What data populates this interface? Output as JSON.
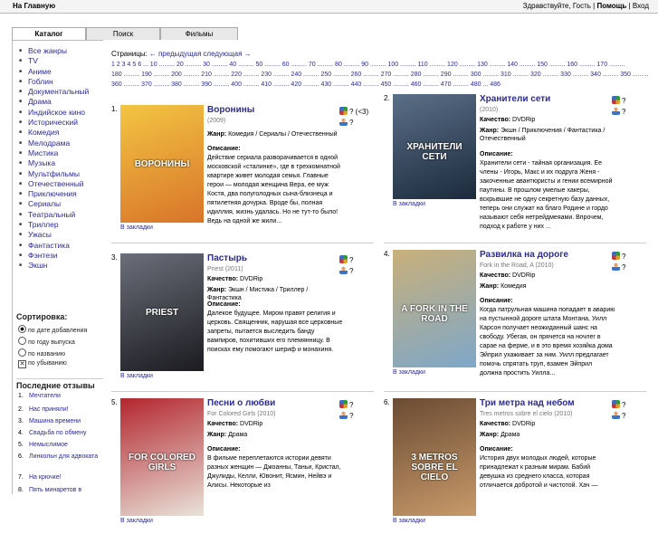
{
  "topbar": {
    "home": "На Главную",
    "greeting": "Здравствуйте, Гость",
    "sep1": " | ",
    "help": "Помощь",
    "sep2": " | ",
    "login": "Вход"
  },
  "tabs": [
    "Каталог",
    "Поиск",
    "Фильмы"
  ],
  "genres": [
    "Все жанры",
    "TV",
    "Аниме",
    "Гоблин",
    "Документальный",
    "Драма",
    "Индийское кино",
    "Исторический",
    "Комедия",
    "Мелодрама",
    "Мистика",
    "Музыка",
    "Мультфильмы",
    "Отечественный",
    "Приключения",
    "Сериалы",
    "Театральный",
    "Триллер",
    "Ужасы",
    "Фантастика",
    "Фэнтези",
    "Экшн"
  ],
  "sort": {
    "title": "Сортировка:",
    "options": [
      "по дате добавления",
      "по году выпуска",
      "по названию",
      "по убыванию"
    ]
  },
  "reviews": {
    "title": "Последние отзывы",
    "items": [
      {
        "n": "1.",
        "t": "Мечтатели"
      },
      {
        "n": "2.",
        "t": "Нас приняли!"
      },
      {
        "n": "3.",
        "t": "Машина времени"
      },
      {
        "n": "4.",
        "t": "Свадьба по обмену"
      },
      {
        "n": "5.",
        "t": "Немыслимое"
      },
      {
        "n": "6.",
        "t": "Линкольн для адвоката"
      },
      {
        "n": "7.",
        "t": "На крючке!"
      },
      {
        "n": "8.",
        "t": "Пять минаретов в"
      }
    ]
  },
  "pagination": {
    "label": "Страницы:",
    "prev": "← предыдущая",
    "next": "следующая →",
    "line2": "1 2 3 4 5 6 ... 10 ......... 20 ......... 30 ......... 40 ......... 50 ......... 60 ......... 70 ......... 80 ......... 90 ......... 100 ......... 110 ......... 120 ......... 130 ......... 140 ......... 150 ......... 160 ......... 170 .........",
    "line3": "180 ......... 190 ......... 200 ......... 210 ......... 220 ......... 230 ......... 240 ......... 250 ......... 260 ......... 270 ......... 280 ......... 290 ......... 300 ......... 310 ......... 320 ......... 330 ......... 340 ......... 350 .........",
    "line4": "360 ......... 370 ......... 380 ......... 390 ......... 400 ......... 410 ......... 420 ......... 430 ......... 440 ......... 450 ......... 460 ......... 470 ......... 480 ... 486"
  },
  "bookmark": "В закладки",
  "labels": {
    "genre": "Жанр:",
    "quality": "Качество:",
    "desc": "Описание:"
  },
  "items": [
    {
      "idx": "1.",
      "title": "Воронины",
      "orig": "(2009)",
      "rating": "? (<3)",
      "user": "?",
      "quality": "",
      "genre": "Комедия / Сериалы / Отечественный",
      "desc": "Действие сериала разворачивается в одной московской «сталинке», где в трехкомнатной квартире живет молодая семья. Главные герои — молодая женщина Вера, ее муж Костя, два полуголодных сына-близнеца и пятилетняя дочурка. Вроде бы, полная идиллия, жизнь удалась. Но не тут-то было! Ведь на одной же жили...",
      "poster": "ВОРОНИНЫ",
      "pc": "#d8742a",
      "pc2": "#f3c542"
    },
    {
      "idx": "2.",
      "title": "Хранители сети",
      "orig": "(2010)",
      "rating": "?",
      "user": "?",
      "quality": "DVDRip",
      "genre": "Экшн / Приключения / Фантастика / Отечественный",
      "desc": "Хранители сети - тайная организация. Ее члены - Игорь, Макс и их подруга Женя - закоченные авантюристы и гении всемирной паутины. В прошлом умелые хакеры, вскрывшие не одну секретную базу данных, теперь они служат на благо Родине и гордо называют себя нетрейдмеяами. Впрочем, подход к работе у них ...",
      "poster": "ХРАНИТЕЛИ СЕТИ",
      "pc": "#1c2a3c",
      "pc2": "#5a6f88"
    },
    {
      "idx": "3.",
      "title": "Пастырь",
      "orig": "Priest (2011)",
      "rating": "?",
      "user": "?",
      "quality": "DVDRip",
      "genre": "Экшн / Мистика / Триллер / Фантастика",
      "desc": "Далекое будущее. Миром правят религия и церковь. Священник, нарушая все церковные запреты, пытается выследить банду вампиров, похитивших его племянницу. В поисках ему помогают шериф и монахиня.",
      "poster": "PRIEST",
      "pc": "#1b1b20",
      "pc2": "#6b6f7a"
    },
    {
      "idx": "4.",
      "title": "Развилка на дороге",
      "orig": "Fork in the Road, A (2010)",
      "rating": "?",
      "user": "?",
      "quality": "DVDRip",
      "genre": "Комедия",
      "desc": "Когда патрульная машина попадает в аварию на пустынной дороге штата Монтана, Уилл Карсон получает неожиданный шанс на свободу. Убегая, он прячется на ночлег в сарае на ферме, и в это время хозяйка дома Эйприл ухаживает за ним. Уилл предлагает помочь спрятать труп, взамен Эйприл должна простить Уилла...",
      "poster": "A FORK IN THE ROAD",
      "pc": "#7ea7c9",
      "pc2": "#c9b07a"
    },
    {
      "idx": "5.",
      "title": "Песни о любви",
      "orig": "For Colored Girls (2010)",
      "rating": "?",
      "user": "?",
      "quality": "DVDRip",
      "genre": "Драма",
      "desc": "В фильме переплетаются истории девяти разных женщин — Джоанны, Таньи, Кристал, Джулиды, Келли, Ювонит, Ясмин, Нейвэ и Алисы. Некоторые из",
      "poster": "FOR COLORED GIRLS",
      "pc": "#e9e3da",
      "pc2": "#b3262e"
    },
    {
      "idx": "6.",
      "title": "Три метра над небом",
      "orig": "Tres metros sobre el cielo (2010)",
      "rating": "?",
      "user": "?",
      "quality": "DVDRip",
      "genre": "Драма",
      "desc": "История двух молодых людей, которые принадлежат к разным мирам. Бабий девушка из среднего класса, которая отличается добротой и чистотой. Хач —",
      "poster": "3 METROS SOBRE EL CIELO",
      "pc": "#c89a6a",
      "pc2": "#6a4b33"
    }
  ]
}
